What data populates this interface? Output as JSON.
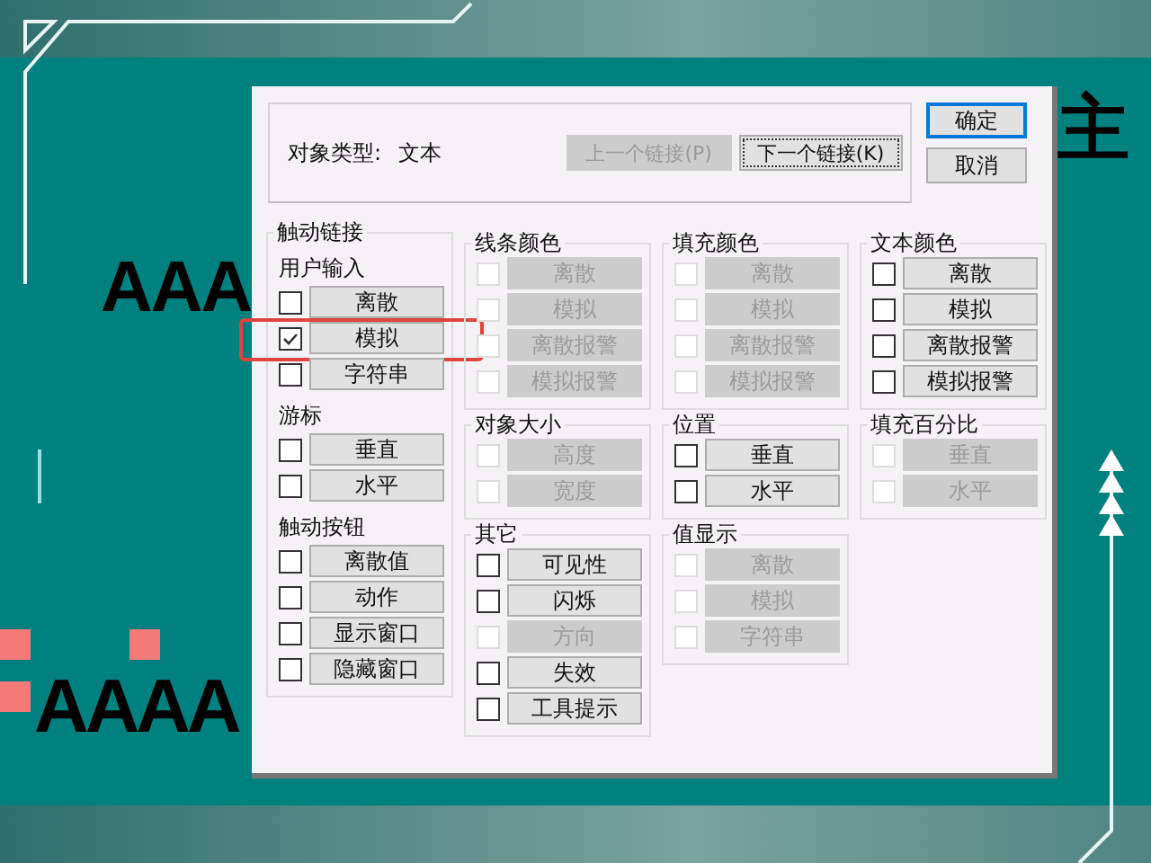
{
  "background_texts": [
    {
      "text": "主",
      "kind": "title-right"
    },
    {
      "text": "AAA",
      "kind": "sample-top"
    },
    {
      "text": "AAAA",
      "kind": "sample-bottom"
    }
  ],
  "dialog": {
    "object_type_label": "对象类型:",
    "object_type_value": "文本",
    "prev_link": {
      "label": "上一个链接(P)",
      "disabled": true
    },
    "next_link": {
      "label": "下一个链接(K)",
      "disabled": false
    },
    "ok": "确定",
    "cancel": "取消",
    "columns": [
      [
        {
          "title": "触动链接",
          "sections": [
            {
              "subtitle": "用户输入",
              "rows": [
                {
                  "label": "离散",
                  "checked": false,
                  "disabled": false,
                  "highlighted": false
                },
                {
                  "label": "模拟",
                  "checked": true,
                  "disabled": false,
                  "highlighted": true
                },
                {
                  "label": "字符串",
                  "checked": false,
                  "disabled": false,
                  "highlighted": false
                }
              ]
            },
            {
              "subtitle": "游标",
              "rows": [
                {
                  "label": "垂直",
                  "checked": false,
                  "disabled": false
                },
                {
                  "label": "水平",
                  "checked": false,
                  "disabled": false
                }
              ]
            },
            {
              "subtitle": "触动按钮",
              "rows": [
                {
                  "label": "离散值",
                  "checked": false,
                  "disabled": false
                },
                {
                  "label": "动作",
                  "checked": false,
                  "disabled": false
                },
                {
                  "label": "显示窗口",
                  "checked": false,
                  "disabled": false
                },
                {
                  "label": "隐藏窗口",
                  "checked": false,
                  "disabled": false
                }
              ]
            }
          ]
        }
      ],
      [
        {
          "title": "线条颜色",
          "sections": [
            {
              "rows": [
                {
                  "label": "离散",
                  "checked": false,
                  "disabled": true
                },
                {
                  "label": "模拟",
                  "checked": false,
                  "disabled": true
                },
                {
                  "label": "离散报警",
                  "checked": false,
                  "disabled": true
                },
                {
                  "label": "模拟报警",
                  "checked": false,
                  "disabled": true
                }
              ]
            }
          ]
        },
        {
          "title": "对象大小",
          "sections": [
            {
              "rows": [
                {
                  "label": "高度",
                  "checked": false,
                  "disabled": true
                },
                {
                  "label": "宽度",
                  "checked": false,
                  "disabled": true
                }
              ]
            }
          ]
        },
        {
          "title": "其它",
          "sections": [
            {
              "rows": [
                {
                  "label": "可见性",
                  "checked": false,
                  "disabled": false
                },
                {
                  "label": "闪烁",
                  "checked": false,
                  "disabled": false
                },
                {
                  "label": "方向",
                  "checked": false,
                  "disabled": true
                },
                {
                  "label": "失效",
                  "checked": false,
                  "disabled": false
                },
                {
                  "label": "工具提示",
                  "checked": false,
                  "disabled": false
                }
              ]
            }
          ]
        }
      ],
      [
        {
          "title": "填充颜色",
          "sections": [
            {
              "rows": [
                {
                  "label": "离散",
                  "checked": false,
                  "disabled": true
                },
                {
                  "label": "模拟",
                  "checked": false,
                  "disabled": true
                },
                {
                  "label": "离散报警",
                  "checked": false,
                  "disabled": true
                },
                {
                  "label": "模拟报警",
                  "checked": false,
                  "disabled": true
                }
              ]
            }
          ]
        },
        {
          "title": "位置",
          "sections": [
            {
              "rows": [
                {
                  "label": "垂直",
                  "checked": false,
                  "disabled": false
                },
                {
                  "label": "水平",
                  "checked": false,
                  "disabled": false
                }
              ]
            }
          ]
        },
        {
          "title": "值显示",
          "sections": [
            {
              "rows": [
                {
                  "label": "离散",
                  "checked": false,
                  "disabled": true
                },
                {
                  "label": "模拟",
                  "checked": false,
                  "disabled": true
                },
                {
                  "label": "字符串",
                  "checked": false,
                  "disabled": true
                }
              ]
            }
          ]
        }
      ],
      [
        {
          "title": "文本颜色",
          "sections": [
            {
              "rows": [
                {
                  "label": "离散",
                  "checked": false,
                  "disabled": false
                },
                {
                  "label": "模拟",
                  "checked": false,
                  "disabled": false
                },
                {
                  "label": "离散报警",
                  "checked": false,
                  "disabled": false
                },
                {
                  "label": "模拟报警",
                  "checked": false,
                  "disabled": false
                }
              ]
            }
          ]
        },
        {
          "title": "填充百分比",
          "sections": [
            {
              "rows": [
                {
                  "label": "垂直",
                  "checked": false,
                  "disabled": true
                },
                {
                  "label": "水平",
                  "checked": false,
                  "disabled": true
                }
              ]
            }
          ]
        }
      ]
    ]
  }
}
